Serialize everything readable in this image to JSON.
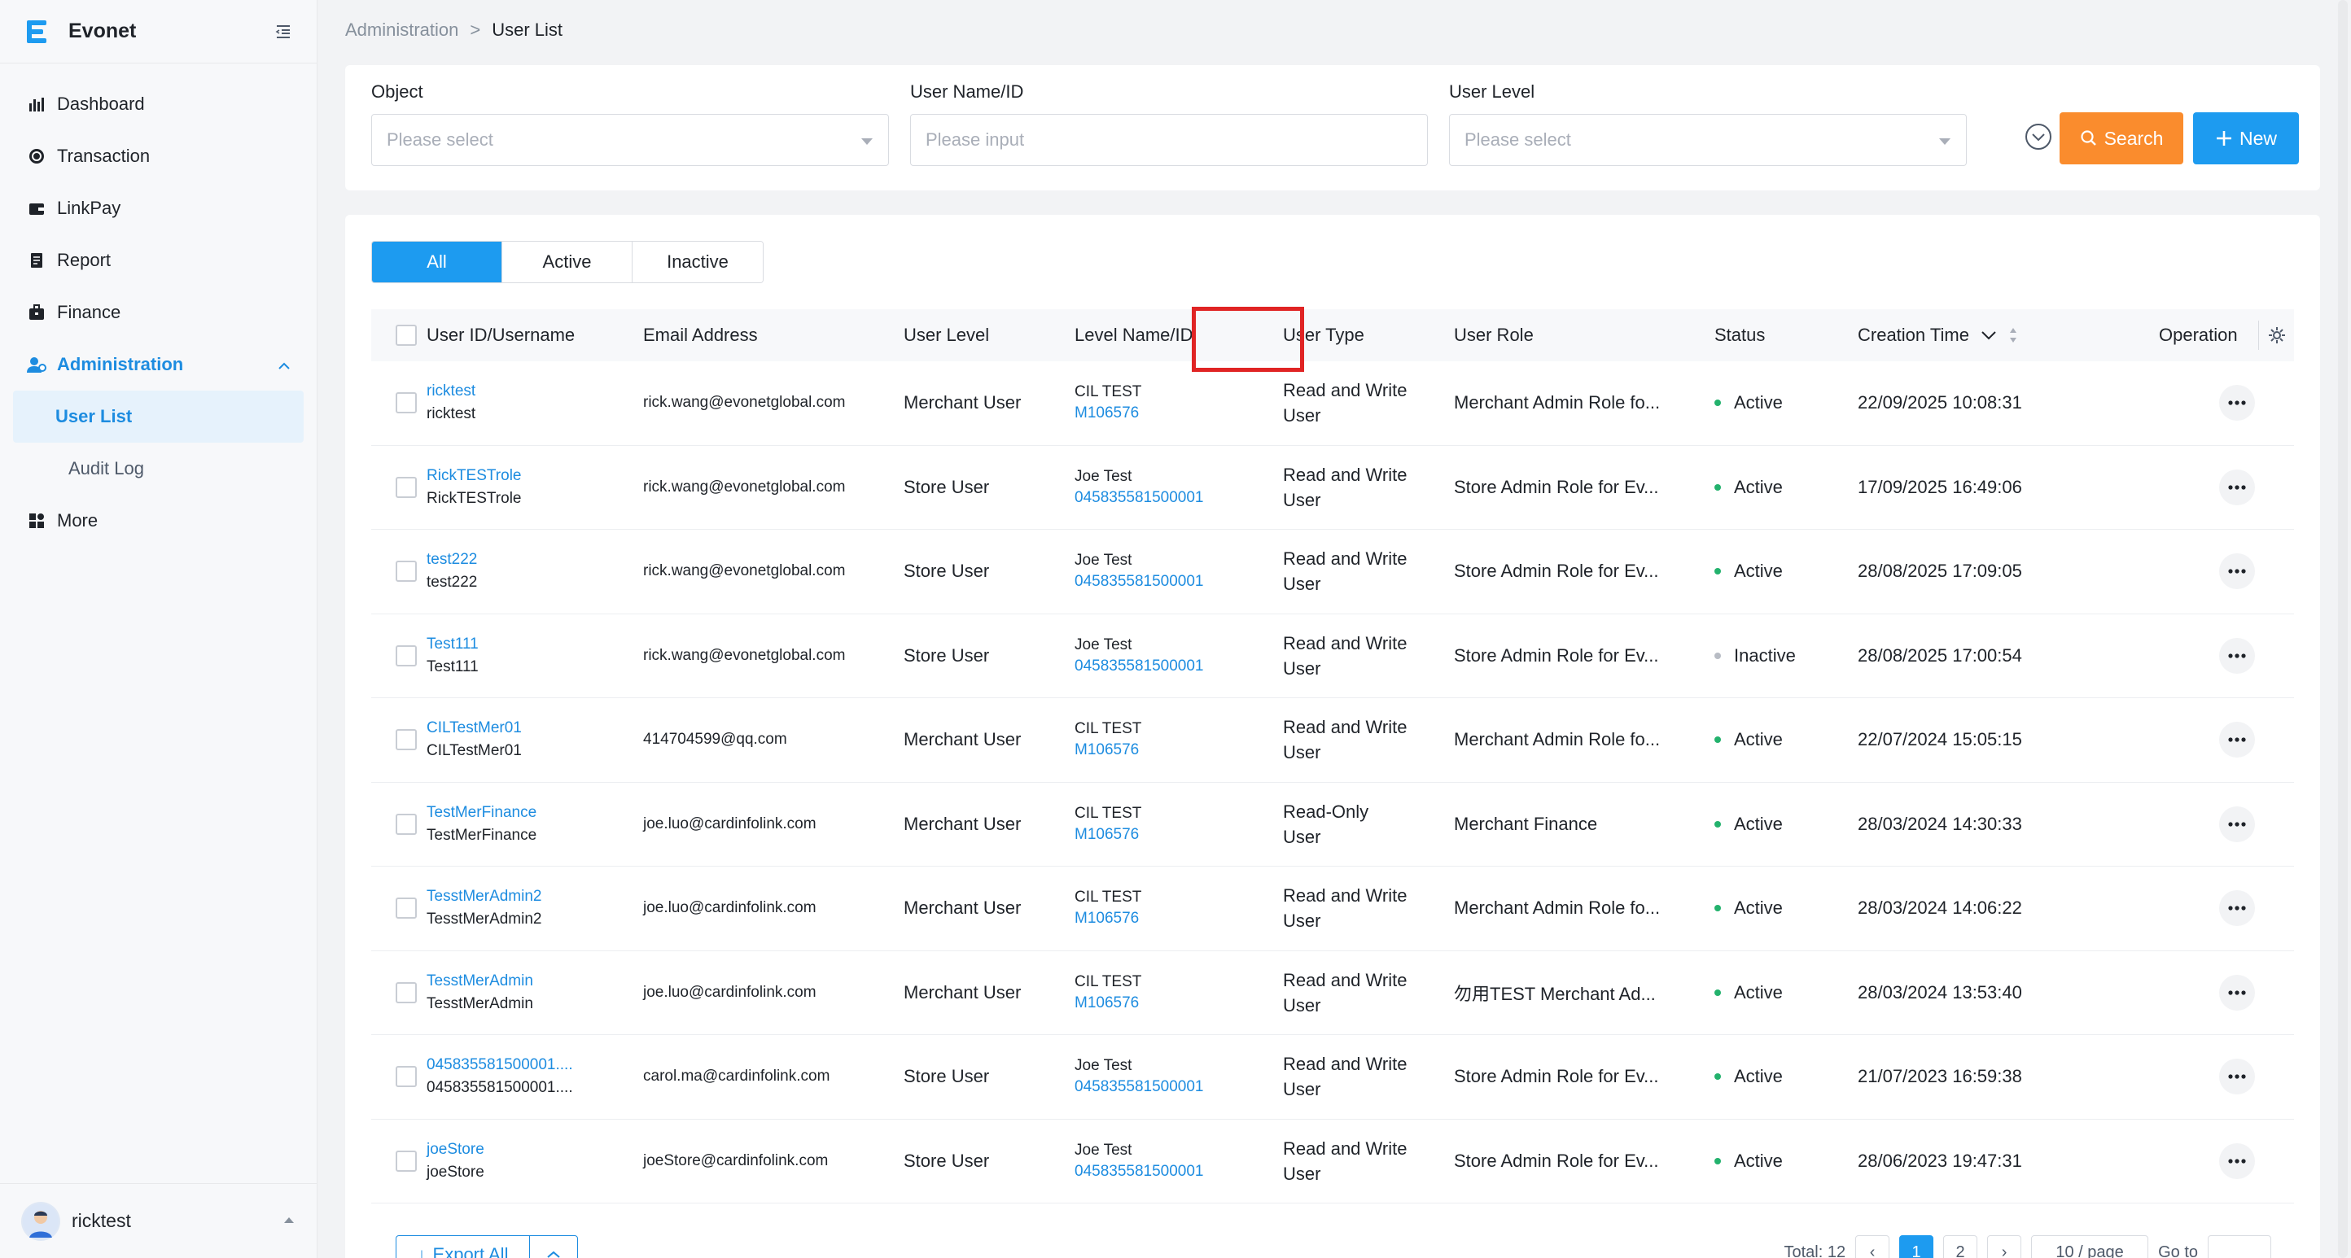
{
  "sidebar": {
    "brand": "Evonet",
    "items": [
      {
        "label": "Dashboard",
        "icon": "bar-chart-icon"
      },
      {
        "label": "Transaction",
        "icon": "coin-icon"
      },
      {
        "label": "LinkPay",
        "icon": "wallet-icon"
      },
      {
        "label": "Report",
        "icon": "report-icon"
      },
      {
        "label": "Finance",
        "icon": "briefcase-icon"
      },
      {
        "label": "Administration",
        "icon": "user-admin-icon"
      }
    ],
    "subitems": [
      {
        "label": "User List"
      },
      {
        "label": "Audit Log"
      }
    ],
    "more": {
      "label": "More",
      "icon": "grid-icon"
    },
    "user": "ricktest"
  },
  "breadcrumb": {
    "parent": "Administration",
    "separator": ">",
    "current": "User List"
  },
  "filters": {
    "object": {
      "label": "Object",
      "placeholder": "Please select"
    },
    "user_name": {
      "label": "User Name/ID",
      "placeholder": "Please input"
    },
    "user_level": {
      "label": "User Level",
      "placeholder": "Please select"
    },
    "search_label": "Search",
    "new_label": "New"
  },
  "tabs": [
    "All",
    "Active",
    "Inactive"
  ],
  "table": {
    "headers": {
      "user": "User ID/Username",
      "email": "Email Address",
      "level": "User Level",
      "level_name": "Level Name/ID",
      "type": "User Type",
      "role": "User Role",
      "status": "Status",
      "created": "Creation Time",
      "operation": "Operation"
    },
    "rows": [
      {
        "uid": "ricktest",
        "uname": "ricktest",
        "email": "rick.wang@evonetglobal.com",
        "level": "Merchant User",
        "lname": "CIL TEST",
        "lid": "M106576",
        "type1": "Read and Write",
        "type2": "User",
        "role": "Merchant Admin Role fo...",
        "status": "Active",
        "created": "22/09/2025 10:08:31"
      },
      {
        "uid": "RickTESTrole",
        "uname": "RickTESTrole",
        "email": "rick.wang@evonetglobal.com",
        "level": "Store User",
        "lname": "Joe Test",
        "lid": "045835581500001",
        "type1": "Read and Write",
        "type2": "User",
        "role": "Store Admin Role for Ev...",
        "status": "Active",
        "created": "17/09/2025 16:49:06"
      },
      {
        "uid": "test222",
        "uname": "test222",
        "email": "rick.wang@evonetglobal.com",
        "level": "Store User",
        "lname": "Joe Test",
        "lid": "045835581500001",
        "type1": "Read and Write",
        "type2": "User",
        "role": "Store Admin Role for Ev...",
        "status": "Active",
        "created": "28/08/2025 17:09:05"
      },
      {
        "uid": "Test111",
        "uname": "Test111",
        "email": "rick.wang@evonetglobal.com",
        "level": "Store User",
        "lname": "Joe Test",
        "lid": "045835581500001",
        "type1": "Read and Write",
        "type2": "User",
        "role": "Store Admin Role for Ev...",
        "status": "Inactive",
        "created": "28/08/2025 17:00:54"
      },
      {
        "uid": "CILTestMer01",
        "uname": "CILTestMer01",
        "email": "414704599@qq.com",
        "level": "Merchant User",
        "lname": "CIL TEST",
        "lid": "M106576",
        "type1": "Read and Write",
        "type2": "User",
        "role": "Merchant Admin Role fo...",
        "status": "Active",
        "created": "22/07/2024 15:05:15"
      },
      {
        "uid": "TestMerFinance",
        "uname": "TestMerFinance",
        "email": "joe.luo@cardinfolink.com",
        "level": "Merchant User",
        "lname": "CIL TEST",
        "lid": "M106576",
        "type1": "Read-Only",
        "type2": "User",
        "role": "Merchant Finance",
        "status": "Active",
        "created": "28/03/2024 14:30:33"
      },
      {
        "uid": "TesstMerAdmin2",
        "uname": "TesstMerAdmin2",
        "email": "joe.luo@cardinfolink.com",
        "level": "Merchant User",
        "lname": "CIL TEST",
        "lid": "M106576",
        "type1": "Read and Write",
        "type2": "User",
        "role": "Merchant Admin Role fo...",
        "status": "Active",
        "created": "28/03/2024 14:06:22"
      },
      {
        "uid": "TesstMerAdmin",
        "uname": "TesstMerAdmin",
        "email": "joe.luo@cardinfolink.com",
        "level": "Merchant User",
        "lname": "CIL TEST",
        "lid": "M106576",
        "type1": "Read and Write",
        "type2": "User",
        "role": "勿用TEST Merchant Ad...",
        "status": "Active",
        "created": "28/03/2024 13:53:40"
      },
      {
        "uid": "045835581500001....",
        "uname": "045835581500001....",
        "email": "carol.ma@cardinfolink.com",
        "level": "Store User",
        "lname": "Joe Test",
        "lid": "045835581500001",
        "type1": "Read and Write",
        "type2": "User",
        "role": "Store Admin Role for Ev...",
        "status": "Active",
        "created": "21/07/2023 16:59:38"
      },
      {
        "uid": "joeStore",
        "uname": "joeStore",
        "email": "joeStore@cardinfolink.com",
        "level": "Store User",
        "lname": "Joe Test",
        "lid": "045835581500001",
        "type1": "Read and Write",
        "type2": "User",
        "role": "Store Admin Role for Ev...",
        "status": "Active",
        "created": "28/06/2023 19:47:31"
      }
    ]
  },
  "footer": {
    "export_label": "Export All",
    "total": "Total: 12",
    "pages": [
      "1",
      "2"
    ],
    "page_size": "10 / page",
    "goto": "Go to"
  },
  "colors": {
    "primary": "#1d9bf0",
    "search": "#fa8c2d",
    "active_dot": "#23b26d",
    "inactive_dot": "#b8bcc4",
    "highlight": "#e02424"
  }
}
